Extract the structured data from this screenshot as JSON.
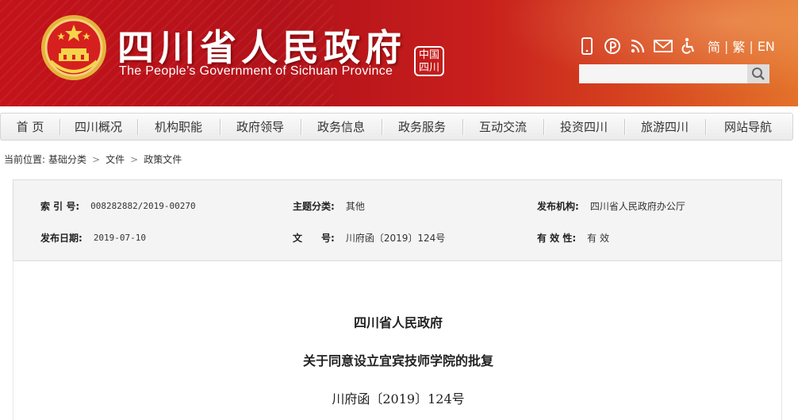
{
  "header": {
    "title": "四川省人民政府",
    "subtitle": "The People’s Government of Sichuan Province",
    "seal_text": "中国四川",
    "icons": [
      "mobile-icon",
      "weibo-icon",
      "rss-icon",
      "mail-icon",
      "accessibility-icon"
    ],
    "languages": [
      "简",
      "繁",
      "EN"
    ],
    "search_placeholder": ""
  },
  "nav": {
    "items": [
      "首 页",
      "四川概况",
      "机构职能",
      "政府领导",
      "政务信息",
      "政务服务",
      "互动交流",
      "投资四川",
      "旅游四川",
      "网站导航"
    ]
  },
  "breadcrumb": {
    "prefix": "当前位置:",
    "items": [
      "基础分类",
      "文件",
      "政策文件"
    ]
  },
  "meta": {
    "index_label": "索 引 号:",
    "index_value": "008282882/2019-00270",
    "topic_label": "主题分类:",
    "topic_value": "其他",
    "publisher_label": "发布机构:",
    "publisher_value": "四川省人民政府办公厅",
    "date_label": "发布日期:",
    "date_value": "2019-07-10",
    "docno_label": "文　　号:",
    "docno_value": "川府函〔2019〕124号",
    "validity_label": "有 效 性:",
    "validity_value": "有 效"
  },
  "document": {
    "issuer": "四川省人民政府",
    "title": "关于同意设立宜宾技师学院的批复",
    "number": "川府函〔2019〕124号"
  },
  "colors": {
    "banner_red": "#c4121a",
    "banner_orange": "#e3722a",
    "nav_bg": "#efefef",
    "meta_bg": "#f4f4f4"
  }
}
